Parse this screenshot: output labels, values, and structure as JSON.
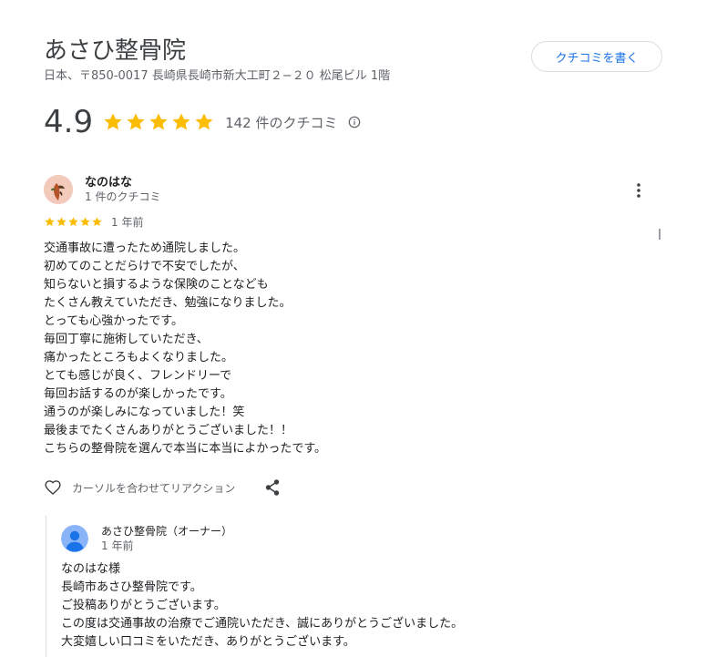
{
  "business": {
    "name": "あさひ整骨院",
    "address": "日本、〒850-0017 長崎県長崎市新大工町２−２０ 松尾ビル 1階",
    "write_review_label": "クチコミを書く",
    "rating": "4.9",
    "rating_stars": 5,
    "review_count": "142 件のクチコミ"
  },
  "review": {
    "reviewer_name": "なのはな",
    "reviewer_meta": "1 件のクチコミ",
    "stars": 5,
    "date": "1 年前",
    "lines": [
      "交通事故に遭ったため通院しました。",
      "初めてのことだらけで不安でしたが、",
      "知らないと損するような保険のことなども",
      "たくさん教えていただき、勉強になりました。",
      "とっても心強かったです。",
      "毎回丁寧に施術していただき、",
      "痛かったところもよくなりました。",
      "とても感じが良く、フレンドリーで",
      "毎回お話するのが楽しかったです。",
      "通うのが楽しみになっていました！笑",
      "最後までたくさんありがとうございました！！",
      "こちらの整骨院を選んで本当に本当によかったです。"
    ],
    "reaction_label": "カーソルを合わせてリアクション"
  },
  "owner_reply": {
    "name": "あさひ整骨院（オーナー）",
    "date": "1 年前",
    "lines": [
      "なのはな様",
      "長崎市あさひ整骨院です。",
      "ご投稿ありがとうございます。",
      "この度は交通事故の治療でご通院いただき、誠にありがとうございました。",
      "大変嬉しい口コミをいただき、ありがとうございます。"
    ]
  },
  "colors": {
    "star": "#fbbc04",
    "accent": "#1a73e8",
    "muted": "#5f6368",
    "owner_avatar": "#8ab4f8"
  },
  "icons": {
    "star": "star-icon",
    "info": "info-icon",
    "more": "more-vert-icon",
    "like": "heart-outline-icon",
    "share": "share-icon",
    "avatar": "user-avatar-icon"
  }
}
